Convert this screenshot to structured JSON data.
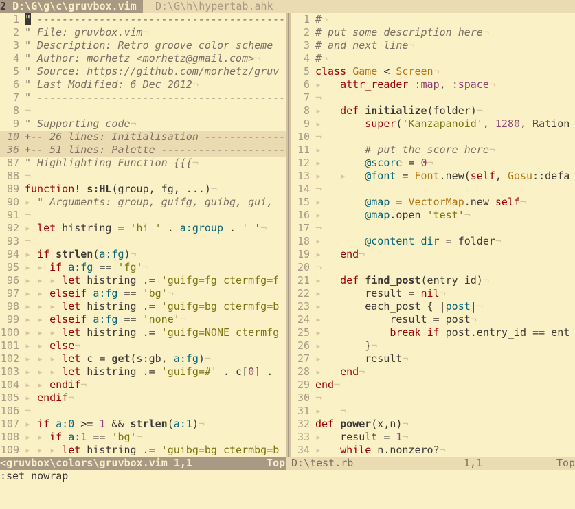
{
  "tabs": {
    "selected": {
      "num": "2",
      "label": "D:\\G\\g\\c\\gruvbox.vim"
    },
    "other": {
      "label": "D:\\G\\h\\hypertab.ahk"
    }
  },
  "left": {
    "lines": [
      {
        "n": "1",
        "cursor": true,
        "html": "<span class=\"c\">\" ---------------------------------------------</span>"
      },
      {
        "n": "2",
        "html": "<span class=\"c\">\" File: gruvbox.vim</span><span class=\"nl\">¬</span>"
      },
      {
        "n": "3",
        "html": "<span class=\"c\">\" Description: Retro groove color scheme</span>"
      },
      {
        "n": "4",
        "html": "<span class=\"c\">\" Author: morhetz &lt;morhetz@gmail.com&gt;</span><span class=\"nl\">¬</span>"
      },
      {
        "n": "5",
        "html": "<span class=\"c\">\" Source: https://github.com/morhetz/gruv</span>"
      },
      {
        "n": "6",
        "html": "<span class=\"c\">\" Last Modified: 6 Dec 2012</span><span class=\"nl\">¬</span>"
      },
      {
        "n": "7",
        "html": "<span class=\"c\">\" ----------------------------------------</span>"
      },
      {
        "n": "8",
        "html": "<span class=\"nl\">¬</span>"
      },
      {
        "n": "9",
        "html": "<span class=\"c\">\" Supporting code</span><span class=\"nl\">¬</span>"
      },
      {
        "n": "10",
        "fold": true,
        "html": "+-- 26 lines: Initialisation -------------"
      },
      {
        "n": "36",
        "fold": true,
        "html": "+-- 51 lines: Palette --------------------"
      },
      {
        "n": "87",
        "html": "<span class=\"c\">\" Highlighting Function {{{</span><span class=\"nl\">¬</span>"
      },
      {
        "n": "88",
        "html": "<span class=\"nl\">¬</span>"
      },
      {
        "n": "89",
        "html": "<span class=\"k\">function!</span> <span class=\"fn\">s:HL</span>(group, fg, ...)<span class=\"nl\">¬</span>"
      },
      {
        "n": "90",
        "html": "<span class=\"nt\">▸</span> <span class=\"c\">\" Arguments: group, guifg, guibg, gui,</span>"
      },
      {
        "n": "91",
        "html": "<span class=\"nl\">¬</span>"
      },
      {
        "n": "92",
        "html": "<span class=\"nt\">▸</span> <span class=\"k\">let</span> histring = <span class=\"s\">'hi '</span> . <span class=\"iv\">a:group</span> . <span class=\"s\">' '</span><span class=\"nl\">¬</span>"
      },
      {
        "n": "93",
        "html": "<span class=\"nl\">¬</span>"
      },
      {
        "n": "94",
        "html": "<span class=\"nt\">▸</span> <span class=\"k\">if</span> <span class=\"fn\">strlen</span>(<span class=\"iv\">a:fg</span>)<span class=\"nl\">¬</span>"
      },
      {
        "n": "95",
        "html": "<span class=\"nt\">▸ ▸</span> <span class=\"k\">if</span> <span class=\"iv\">a:fg</span> == <span class=\"s\">'fg'</span><span class=\"nl\">¬</span>"
      },
      {
        "n": "96",
        "html": "<span class=\"nt\">▸ ▸ ▸</span> <span class=\"k\">let</span> histring .= <span class=\"s\">'guifg=fg ctermfg=f</span>"
      },
      {
        "n": "97",
        "html": "<span class=\"nt\">▸ ▸</span> <span class=\"k\">elseif</span> <span class=\"iv\">a:fg</span> == <span class=\"s\">'bg'</span><span class=\"nl\">¬</span>"
      },
      {
        "n": "98",
        "html": "<span class=\"nt\">▸ ▸ ▸</span> <span class=\"k\">let</span> histring .= <span class=\"s\">'guifg=bg ctermfg=b</span>"
      },
      {
        "n": "99",
        "html": "<span class=\"nt\">▸ ▸</span> <span class=\"k\">elseif</span> <span class=\"iv\">a:fg</span> == <span class=\"s\">'none'</span><span class=\"nl\">¬</span>"
      },
      {
        "n": "100",
        "html": "<span class=\"nt\">▸ ▸ ▸</span> <span class=\"k\">let</span> histring .= <span class=\"s\">'guifg=NONE ctermfg</span>"
      },
      {
        "n": "101",
        "html": "<span class=\"nt\">▸ ▸</span> <span class=\"k\">else</span><span class=\"nl\">¬</span>"
      },
      {
        "n": "102",
        "html": "<span class=\"nt\">▸ ▸ ▸</span> <span class=\"k\">let</span> c = <span class=\"fn\">get</span>(s:gb, <span class=\"iv\">a:fg</span>)<span class=\"nl\">¬</span>"
      },
      {
        "n": "103",
        "html": "<span class=\"nt\">▸ ▸ ▸</span> <span class=\"k\">let</span> histring .= <span class=\"s\">'guifg=#'</span> . c[<span class=\"nm\">0</span>] ."
      },
      {
        "n": "104",
        "html": "<span class=\"nt\">▸ ▸</span> <span class=\"k\">endif</span><span class=\"nl\">¬</span>"
      },
      {
        "n": "105",
        "html": "<span class=\"nt\">▸</span> <span class=\"k\">endif</span><span class=\"nl\">¬</span>"
      },
      {
        "n": "106",
        "html": "<span class=\"nl\">¬</span>"
      },
      {
        "n": "107",
        "html": "<span class=\"nt\">▸</span> <span class=\"k\">if</span> <span class=\"iv\">a:0</span> &gt;= <span class=\"nm\">1</span> &amp;&amp; <span class=\"fn\">strlen</span>(<span class=\"iv\">a:1</span>)<span class=\"nl\">¬</span>"
      },
      {
        "n": "108",
        "html": "<span class=\"nt\">▸ ▸</span> <span class=\"k\">if</span> <span class=\"iv\">a:1</span> == <span class=\"s\">'bg'</span><span class=\"nl\">¬</span>"
      },
      {
        "n": "109",
        "html": "<span class=\"nt\">▸ ▸ ▸</span> <span class=\"k\">let</span> histring .= <span class=\"s\">'guibg=bg ctermbg=b</span>"
      }
    ]
  },
  "right": {
    "lines": [
      {
        "n": "1",
        "html": "<span class=\"c\">#</span><span class=\"nl\">¬</span>"
      },
      {
        "n": "2",
        "html": "<span class=\"c\"># put some description here</span><span class=\"nl\">¬</span>"
      },
      {
        "n": "3",
        "html": "<span class=\"c\"># and next line</span><span class=\"nl\">¬</span>"
      },
      {
        "n": "4",
        "html": "<span class=\"c\">#</span><span class=\"nl\">¬</span>"
      },
      {
        "n": "5",
        "html": "<span class=\"k\">class</span> <span class=\"ty\">Game</span> &lt; <span class=\"ty\">Screen</span><span class=\"nl\">¬</span>"
      },
      {
        "n": "6",
        "html": "<span class=\"nt\">▸</span>   <span class=\"k\">attr_reader</span> <span class=\"nm\">:map</span>, <span class=\"nm\">:space</span><span class=\"nl\">¬</span>"
      },
      {
        "n": "7",
        "html": "<span class=\"nl\">¬</span>"
      },
      {
        "n": "8",
        "html": "<span class=\"nt\">▸</span>   <span class=\"k\">def</span> <span class=\"fn\">initialize</span>(folder)<span class=\"nl\">¬</span>"
      },
      {
        "n": "9",
        "html": "<span class=\"nt\">▸</span>       <span class=\"k\">super</span>(<span class=\"s\">'Kanzapanoid'</span>, <span class=\"nm\">1280</span>, Ration"
      },
      {
        "n": "10",
        "html": "<span class=\"nl\">¬</span>"
      },
      {
        "n": "11",
        "html": "<span class=\"nt\">▸</span>       <span class=\"c\"># put the score here</span><span class=\"nl\">¬</span>"
      },
      {
        "n": "12",
        "html": "<span class=\"nt\">▸</span>       <span class=\"iv\">@score</span> = <span class=\"nm\">0</span><span class=\"nl\">¬</span>"
      },
      {
        "n": "13",
        "html": "<span class=\"nt\">▸   ▸</span>   <span class=\"iv\">@font</span> = <span class=\"ty\">Font</span>.new(<span class=\"k\">self</span>, <span class=\"ty\">Gosu</span>::defa"
      },
      {
        "n": "14",
        "html": "<span class=\"nl\">¬</span>"
      },
      {
        "n": "15",
        "html": "<span class=\"nt\">▸</span>       <span class=\"iv\">@map</span> = <span class=\"ty\">VectorMap</span>.new <span class=\"k\">self</span><span class=\"nl\">¬</span>"
      },
      {
        "n": "16",
        "html": "<span class=\"nt\">▸</span>       <span class=\"iv\">@map</span>.open <span class=\"s\">'test'</span><span class=\"nl\">¬</span>"
      },
      {
        "n": "17",
        "html": "<span class=\"nl\">¬</span>"
      },
      {
        "n": "18",
        "html": "<span class=\"nt\">▸</span>       <span class=\"iv\">@content_dir</span> = folder<span class=\"nl\">¬</span>"
      },
      {
        "n": "19",
        "html": "<span class=\"nt\">▸</span>   <span class=\"k\">end</span><span class=\"nl\">¬</span>"
      },
      {
        "n": "20",
        "html": "<span class=\"nl\">¬</span>"
      },
      {
        "n": "21",
        "html": "<span class=\"nt\">▸</span>   <span class=\"k\">def</span> <span class=\"fn\">find_post</span>(entry_id)<span class=\"nl\">¬</span>"
      },
      {
        "n": "22",
        "html": "<span class=\"nt\">▸</span>       result = <span class=\"k\">nil</span><span class=\"nl\">¬</span>"
      },
      {
        "n": "23",
        "html": "<span class=\"nt\">▸</span>       each_post { |<span class=\"iv\">post</span>|<span class=\"nl\">¬</span>"
      },
      {
        "n": "24",
        "html": "<span class=\"nt\">▸</span>           result = post<span class=\"nl\">¬</span>"
      },
      {
        "n": "25",
        "html": "<span class=\"nt\">▸</span>           <span class=\"k\">break</span> <span class=\"k\">if</span> post.entry_id == ent"
      },
      {
        "n": "26",
        "html": "<span class=\"nt\">▸</span>       }<span class=\"nl\">¬</span>"
      },
      {
        "n": "27",
        "html": "<span class=\"nt\">▸</span>       result<span class=\"nl\">¬</span>"
      },
      {
        "n": "28",
        "html": "<span class=\"nt\">▸</span>   <span class=\"k\">end</span><span class=\"nl\">¬</span>"
      },
      {
        "n": "29",
        "html": "<span class=\"k\">end</span><span class=\"nl\">¬</span>"
      },
      {
        "n": "30",
        "html": "<span class=\"nl\">¬</span>"
      },
      {
        "n": "31",
        "html": "<span class=\"nt\">▸</span>   <span class=\"nl\">¬</span>"
      },
      {
        "n": "32",
        "html": "<span class=\"k\">def</span> <span class=\"fn\">power</span>(x,n)<span class=\"nl\">¬</span>"
      },
      {
        "n": "33",
        "html": "<span class=\"nt\">▸</span>   result = <span class=\"nm\">1</span><span class=\"nl\">¬</span>"
      },
      {
        "n": "34",
        "html": "<span class=\"nt\">▸</span>   <span class=\"k\">while</span> n.nonzero?<span class=\"nl\">¬</span>"
      }
    ]
  },
  "status": {
    "left": {
      "file": "<gruvbox\\colors\\gruvbox.vim 1,1",
      "pos": "Top"
    },
    "right": {
      "file": "D:\\test.rb",
      "cursor": "1,1",
      "pos": "Top"
    }
  },
  "cmdline": ":set nowrap",
  "colors": {
    "bg": "#fbf1c7",
    "fg": "#3c3836",
    "keyword": "#9d0006",
    "string": "#79740e",
    "number": "#8f3f71",
    "comment": "#7c6f64"
  }
}
